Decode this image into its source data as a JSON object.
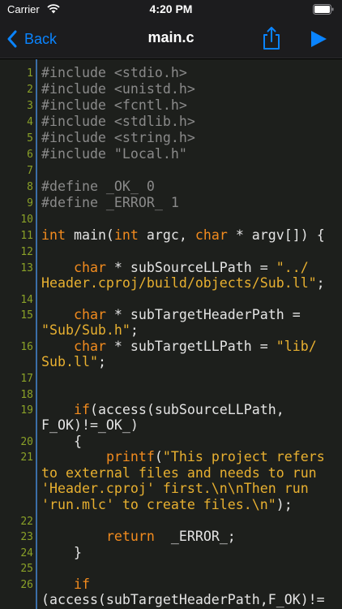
{
  "status": {
    "carrier": "Carrier",
    "time": "4:20 PM"
  },
  "nav": {
    "back_label": "Back",
    "title": "main.c"
  },
  "icons": {
    "wifi": "wifi-icon",
    "battery": "battery-icon",
    "back": "chevron-left-icon",
    "share": "share-icon",
    "run": "play-icon"
  },
  "colors": {
    "accent": "#0a84ff",
    "keyword": "#f28b1e",
    "string": "#e8b030",
    "preprocessor": "#8a8a8a",
    "line_number": "#8aa128",
    "gutter": "#3b6ea8",
    "editor_bg": "#1d1f1c"
  },
  "code": {
    "line_numbers": [
      "1",
      "2",
      "3",
      "4",
      "5",
      "6",
      "7",
      "8",
      "9",
      "10",
      "11",
      "12",
      "13",
      "14",
      "15",
      "16",
      "17",
      "18",
      "19",
      "20",
      "21",
      "22",
      "23",
      "24",
      "25",
      "26"
    ],
    "l1": "#include <stdio.h>",
    "l2": "#include <unistd.h>",
    "l3": "#include <fcntl.h>",
    "l4": "#include <stdlib.h>",
    "l5": "#include <string.h>",
    "l6": "#include \"Local.h\"",
    "l8": "#define _OK_ 0",
    "l9": "#define _ERROR_ 1",
    "l11": {
      "kw1": "int",
      "t1": " main(",
      "kw2": "int",
      "t2": " argc, ",
      "kw3": "char",
      "t3": " * argv[]) {"
    },
    "l13": {
      "indent": "    ",
      "kw": "char",
      "t": " * subSourceLLPath = ",
      "s1": "\"../",
      "s2": "Header.cproj/build/objects/Sub.ll\"",
      "end": ";"
    },
    "l15": {
      "indent": "    ",
      "kw": "char",
      "t": " * subTargetHeaderPath =",
      "s": "\"Sub/Sub.h\"",
      "end": ";"
    },
    "l16": {
      "indent": "    ",
      "kw": "char",
      "t": " * subTargetLLPath = ",
      "s1": "\"lib/",
      "s2": "Sub.ll\"",
      "end": ";"
    },
    "l19": {
      "indent": "    ",
      "kw": "if",
      "t1": "(access(subSourceLLPath,",
      "t2": "F_OK)!=_OK_)"
    },
    "l20": "    {",
    "l21": {
      "indent": "        ",
      "fn": "printf",
      "t": "(",
      "s1": "\"This project refers",
      "s2": "to external files and needs to run",
      "s3": "'Header.cproj' first.\\n\\nThen run",
      "s4": "'run.mlc' to create files.\\n\"",
      "end": ");"
    },
    "l23": {
      "indent": "        ",
      "kw": "return",
      "t": "  _ERROR_;"
    },
    "l24": "    }",
    "l26": {
      "indent": "    ",
      "kw": "if",
      "t": "(access(subTargetHeaderPath,F_OK)!="
    }
  }
}
